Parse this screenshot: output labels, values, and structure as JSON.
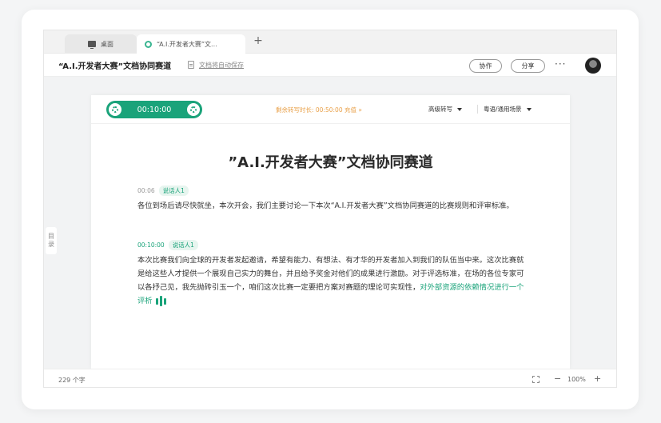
{
  "tabs": [
    {
      "label": "桌面",
      "icon": "monitor-icon"
    },
    {
      "label": "“A.I.开发者大赛”文...",
      "icon": "app-logo-icon"
    }
  ],
  "new_tab_label": "+",
  "doc": {
    "title": "“A.I.开发者大赛”文档协同赛道",
    "save_status": "文档将自动保存",
    "collab_label": "协作",
    "share_label": "分享",
    "more_label": "···"
  },
  "sidebar": {
    "outline_label_1": "目",
    "outline_label_2": "录"
  },
  "recorder": {
    "timer": "00:10:00",
    "remaining": "剩余转写时长: 00:50:00  充值 »",
    "advanced_label": "高级转写",
    "scene_label": "粤语/通用场景",
    "accent_color": "#1aa37a"
  },
  "content": {
    "heading": "”A.I.开发者大赛”文档协同赛道",
    "paragraphs": [
      {
        "timestamp": "00:06",
        "speaker": "说话人1",
        "text": "各位到场后请尽快就坐，本次开会，我们主要讨论一下本次“A.I.开发者大赛”文档协同赛道的比赛规则和评审标准。",
        "live_text": ""
      },
      {
        "timestamp": "00:10:00",
        "speaker": "说话人1",
        "text": "本次比赛我们向全球的开发者发起邀请，希望有能力、有想法、有才华的开发者加入到我们的队伍当中来。这次比赛就是给这些人才提供一个展现自己实力的舞台，并且给予奖金对他们的成果进行激励。对于评选标准，在场的各位专家可以各抒己见，我先抛砖引玉一个，咱们这次比赛一定要把方案对赛题的理论可实现性，",
        "live_text": "对外部资源的依赖情况进行一个评析"
      }
    ]
  },
  "status": {
    "word_count": "229 个字",
    "zoom_minus": "−",
    "zoom": "100%",
    "zoom_plus": "+"
  }
}
